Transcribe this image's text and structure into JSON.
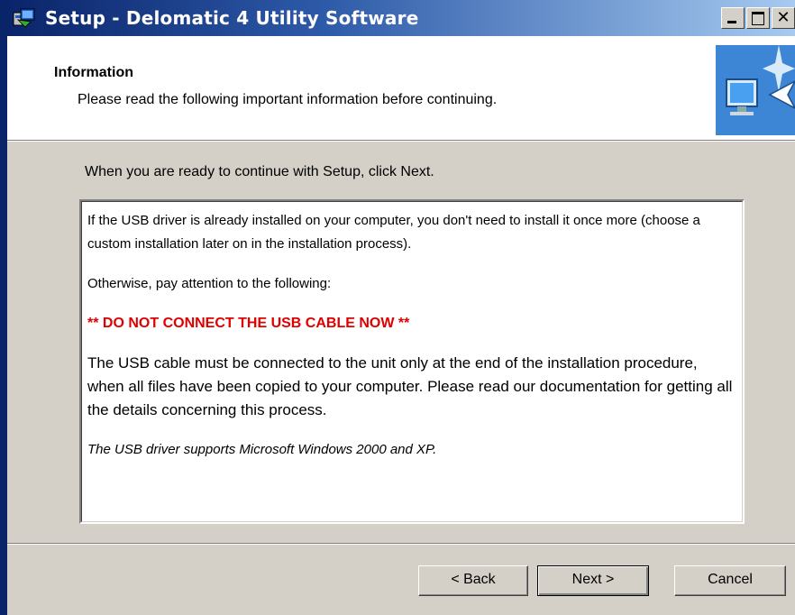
{
  "window": {
    "title": "Setup - Delomatic 4 Utility Software",
    "title_icon": "setup-app-icon",
    "controls": [
      "minimize",
      "maximize",
      "close"
    ]
  },
  "header": {
    "title": "Information",
    "subtitle": "Please read the following important information before continuing.",
    "image_icon": "computer-wizard-icon"
  },
  "main": {
    "instruction": "When you are ready to continue with Setup, click Next.",
    "memo": {
      "line1": "If the USB driver is already installed on your computer, you don't need to install it once more (choose a custom installation later on in the installation process).",
      "line2": "Otherwise, pay attention to the following:",
      "warning": "** DO NOT CONNECT THE USB CABLE NOW **",
      "line3": "The USB cable must be connected to the unit only at the end of the installation procedure, when all files have been copied to your computer. Please read our documentation for getting all the details concerning this process.",
      "note": "The USB driver supports Microsoft Windows 2000 and XP."
    }
  },
  "buttons": {
    "back": "< Back",
    "next": "Next >",
    "cancel": "Cancel"
  },
  "colors": {
    "titlebar_start": "#0a246a",
    "titlebar_end": "#a6caf0",
    "dialog_bg": "#d4d0c8",
    "warning": "#e00000"
  }
}
